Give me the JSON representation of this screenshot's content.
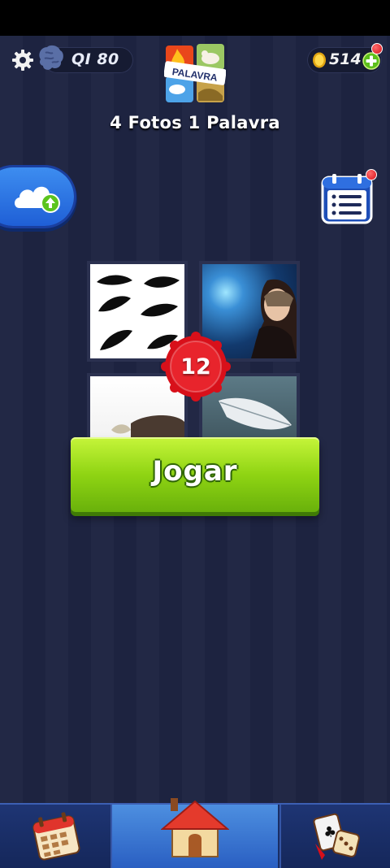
{
  "header": {
    "iq_label": "QI 80",
    "coins": "514",
    "logo_word": "PALAVRA",
    "title": "4 Fotos 1 Palavra"
  },
  "puzzle": {
    "level": "12"
  },
  "play_button": {
    "label": "Jogar"
  },
  "icons": {
    "settings": "gear-icon",
    "iq": "brain-icon",
    "coin": "coin-icon",
    "add_coins": "plus-icon",
    "cloud_sync": "cloud-upload-icon",
    "calendar": "calendar-list-icon",
    "nav_daily": "calendar-icon",
    "nav_home": "house-icon",
    "nav_games": "cards-dice-icon"
  },
  "colors": {
    "accent_green": "#8fd413",
    "badge_red": "#d8101a",
    "nav_active": "#3a75d6",
    "background": "#222845"
  }
}
